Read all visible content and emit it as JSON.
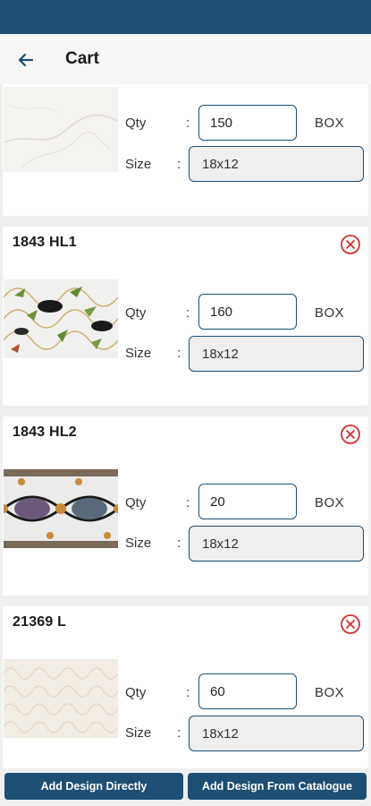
{
  "header": {
    "title": "Cart"
  },
  "labels": {
    "qty": "Qty",
    "size": "Size",
    "colon": ":"
  },
  "items": [
    {
      "name": "",
      "qty": "150",
      "unit": "BOX",
      "size": "18x12"
    },
    {
      "name": "1843 HL1",
      "qty": "160",
      "unit": "BOX",
      "size": "18x12"
    },
    {
      "name": "1843 HL2",
      "qty": "20",
      "unit": "BOX",
      "size": "18x12"
    },
    {
      "name": "21369 L",
      "qty": "60",
      "unit": "BOX",
      "size": "18x12"
    }
  ],
  "footer": {
    "add_direct_label": "Add Design Directly",
    "add_catalogue_label": "Add Design From Catalogue"
  },
  "colors": {
    "primary": "#1d4e73",
    "remove": "#d32f2f"
  }
}
